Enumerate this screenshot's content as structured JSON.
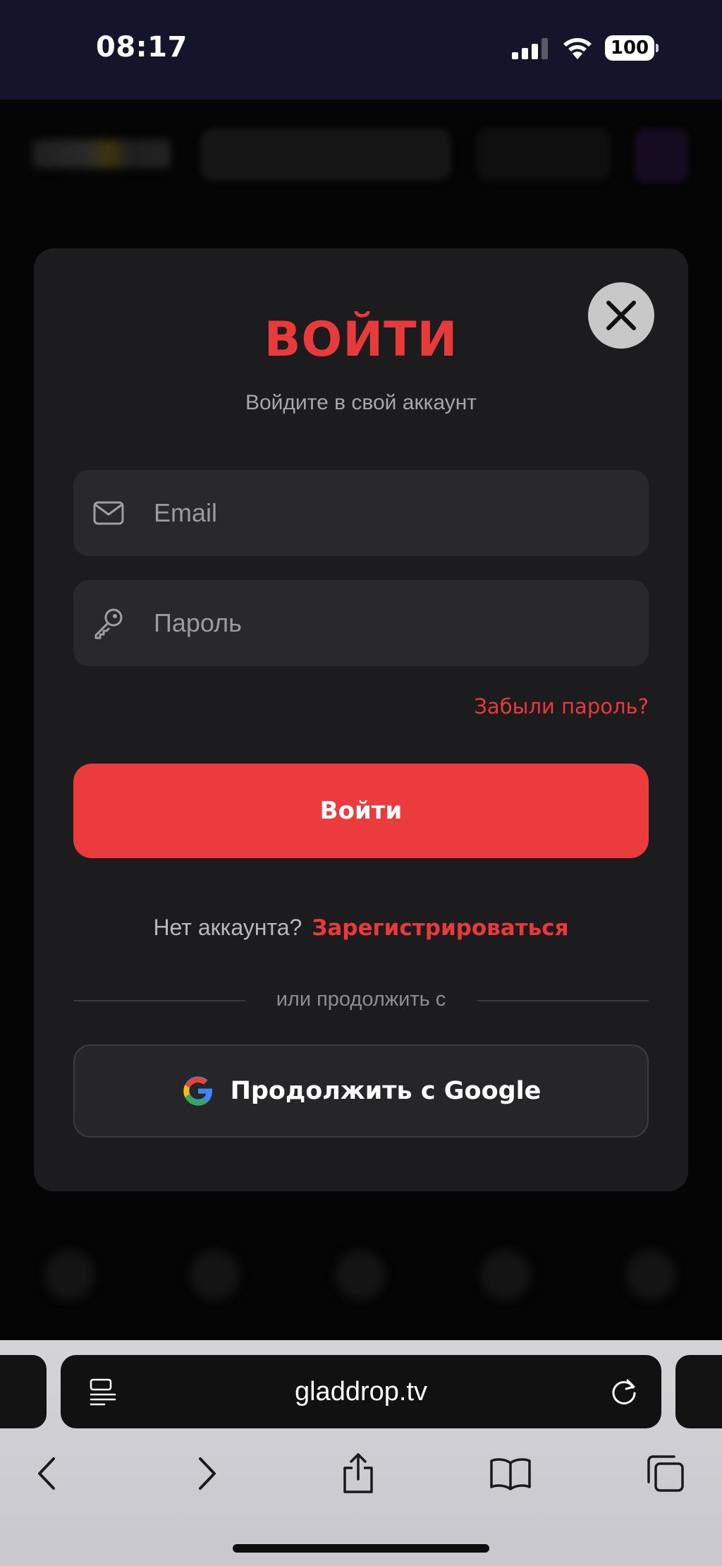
{
  "status_bar": {
    "time": "08:17",
    "battery": "100"
  },
  "modal": {
    "title": "ВОЙТИ",
    "subtitle": "Войдите в свой аккаунт",
    "email_placeholder": "Email",
    "password_placeholder": "Пароль",
    "forgot_password": "Забыли пароль?",
    "login_button": "Войти",
    "signup_prompt": "Нет аккаунта?",
    "signup_link": "Зарегистрироваться",
    "divider_text": "или продолжить с",
    "google_button": "Продолжить с Google"
  },
  "browser": {
    "url": "gladdrop.tv"
  },
  "colors": {
    "accent": "#ec3b3d",
    "modal_bg": "#1c1c1e",
    "input_bg": "#29292c"
  },
  "icons": {
    "close": "close-icon",
    "email": "mail-icon",
    "password": "key-icon",
    "google": "google-icon",
    "reader": "reader-icon",
    "reload": "reload-icon",
    "back": "chevron-left-icon",
    "forward": "chevron-right-icon",
    "share": "share-icon",
    "bookmarks": "book-icon",
    "tabs": "tabs-icon"
  }
}
